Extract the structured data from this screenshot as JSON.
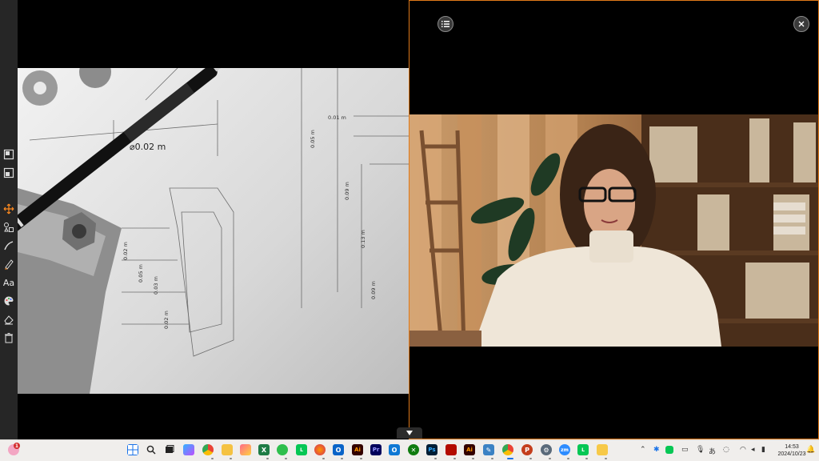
{
  "toolbar": {
    "tools": [
      "layout-single-icon",
      "layout-split-icon",
      "move-icon",
      "shapes-icon",
      "highlighter-icon",
      "pen-icon",
      "text-icon",
      "palette-icon",
      "eraser-icon",
      "trash-icon"
    ],
    "active_color": "#ff8a1f",
    "text_tool_label": "Aa"
  },
  "left_pane": {
    "image": "engineering blueprint with pen",
    "labels": [
      "⌀0.02 m",
      "0.01 m",
      "0.05 m",
      "0.09 m",
      "0.13 m",
      "0.02 m",
      "0.05 m",
      "0.03 m",
      "0.02 m",
      "0.09 m"
    ]
  },
  "right_pane": {
    "image": "woman with glasses at desk in front of bookshelf",
    "border_color": "#e07a1a"
  },
  "taskbar": {
    "clock_time": "14:53",
    "clock_date": "2024/10/23",
    "notification_count": "1",
    "ime_label": "あ",
    "apps": [
      "windows-start",
      "search",
      "task-view",
      "copilot",
      "chrome",
      "file-explorer",
      "photos",
      "excel",
      "wechat",
      "line",
      "firefox",
      "outlook",
      "illustrator",
      "premiere",
      "outlook-new",
      "xbox",
      "photoshop",
      "acrobat",
      "illustrator-2",
      "pen-app",
      "chrome-2",
      "powerpoint",
      "settings",
      "zoom",
      "line-2",
      "notes"
    ]
  }
}
